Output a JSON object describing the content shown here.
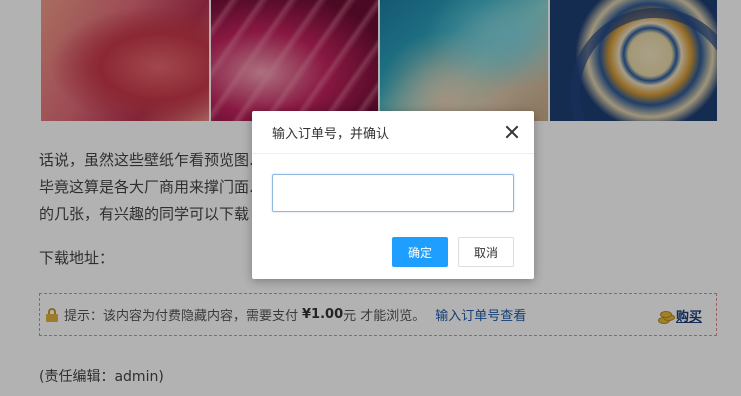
{
  "article": {
    "paragraph_line1": "话说，虽然这些壁纸乍看预览图……上的效果还是挺惊艳的！",
    "paragraph_line2": "毕竟这算是各大厂商用来撑门面……人比较喜欢一加和 OPPO",
    "paragraph_line3": "的几张，有兴趣的同学可以下载",
    "download_label": "下载地址：",
    "editor": "(责任编辑：admin)"
  },
  "paywall": {
    "tip_prefix": "提示：该内容为付费隐藏内容，需要支付",
    "price": "¥1.00",
    "tip_suffix": "元 才能浏览。",
    "order_link": "输入订单号查看",
    "buy_label": "购买",
    "border_color": "#e08a8a"
  },
  "modal": {
    "title": "输入订单号，并确认",
    "input_value": "",
    "ok_label": "确定",
    "cancel_label": "取消",
    "accent": "#1e9fff"
  },
  "icons": [
    "lock-icon",
    "close-icon",
    "coins-icon"
  ]
}
